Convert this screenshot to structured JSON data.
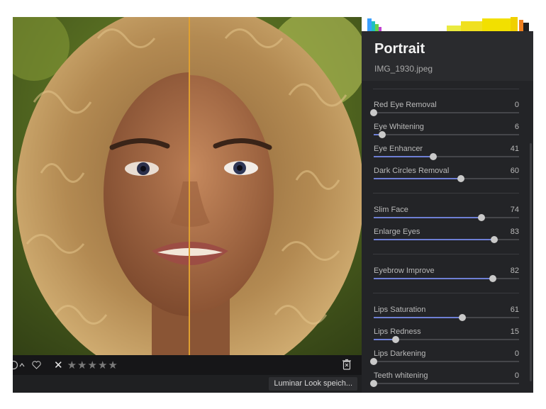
{
  "panel": {
    "title": "Portrait",
    "filename": "IMG_1930.jpeg"
  },
  "sliders": [
    {
      "label": "Red Eye Removal",
      "value": 0
    },
    {
      "label": "Eye Whitening",
      "value": 6
    },
    {
      "label": "Eye Enhancer",
      "value": 41
    },
    {
      "label": "Dark Circles Removal",
      "value": 60
    },
    {
      "label": "Slim Face",
      "value": 74
    },
    {
      "label": "Enlarge Eyes",
      "value": 83
    },
    {
      "label": "Eyebrow Improve",
      "value": 82
    },
    {
      "label": "Lips Saturation",
      "value": 61
    },
    {
      "label": "Lips Redness",
      "value": 15
    },
    {
      "label": "Lips Darkening",
      "value": 0
    },
    {
      "label": "Teeth whitening",
      "value": 0
    }
  ],
  "toolbar": {
    "reject_glyph": "✕",
    "rating": 0,
    "rating_max": 5
  },
  "toast": {
    "text": "Luminar Look speich..."
  },
  "colors": {
    "accent": "#6e7fd4",
    "split_line": "#e0a030"
  },
  "icons": [
    "info-icon",
    "chevron-up-icon",
    "heart-icon",
    "reject-icon",
    "star-icon",
    "trash-icon"
  ]
}
